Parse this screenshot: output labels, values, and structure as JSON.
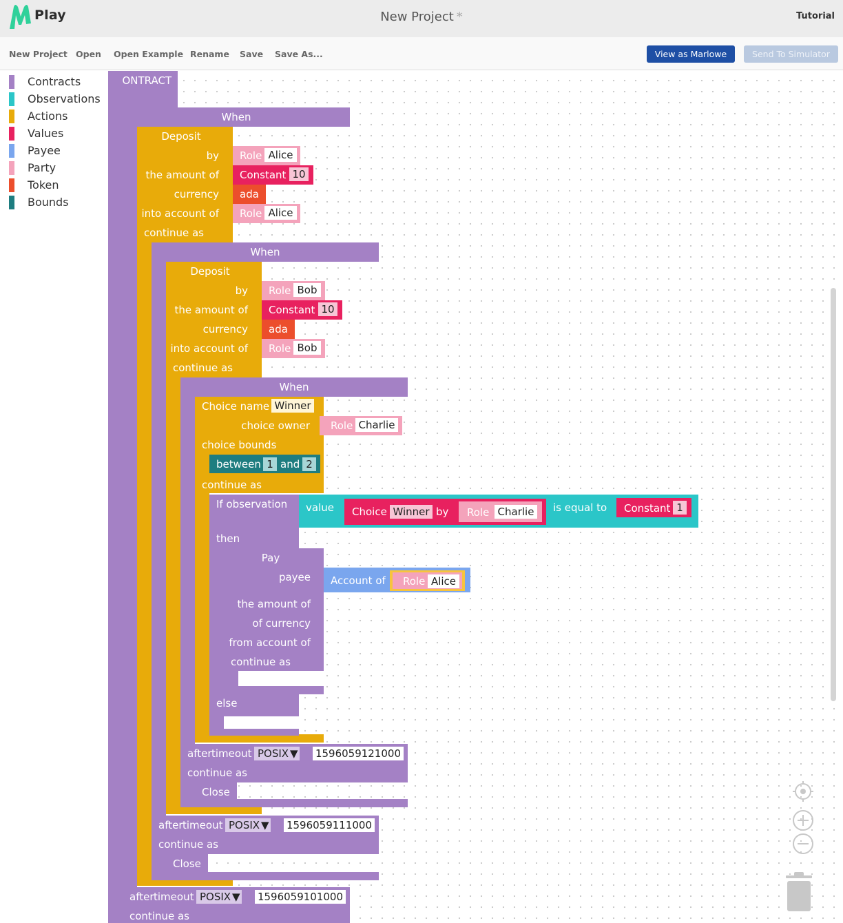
{
  "app": {
    "logo_text": "Play",
    "project_title": "New Project",
    "unsaved_mark": "*",
    "tutorial_label": "Tutorial"
  },
  "menu": {
    "new_project": "New Project",
    "open": "Open",
    "open_example": "Open Example",
    "rename": "Rename",
    "save": "Save",
    "save_as": "Save As...",
    "view_as_marlowe": "View as Marlowe",
    "send_to_simulator": "Send To Simulator"
  },
  "toolbox": [
    {
      "label": "Contracts",
      "color": "#a481c5"
    },
    {
      "label": "Observations",
      "color": "#2bc6c8"
    },
    {
      "label": "Actions",
      "color": "#e8ab0a"
    },
    {
      "label": "Values",
      "color": "#e8215f"
    },
    {
      "label": "Payee",
      "color": "#7aa6ee"
    },
    {
      "label": "Party",
      "color": "#f4a3bb"
    },
    {
      "label": "Token",
      "color": "#ec4e2c"
    },
    {
      "label": "Bounds",
      "color": "#1e7d80"
    }
  ],
  "blocks": {
    "contract": "CONTRACT",
    "when": "When",
    "deposit": "Deposit",
    "by": "by",
    "the_amount_of": "the amount of",
    "currency": "currency",
    "into_account_of": "into account of",
    "continue_as": "continue as",
    "role": "Role",
    "constant": "Constant",
    "ada": "ada",
    "alice": "Alice",
    "bob": "Bob",
    "charlie": "Charlie",
    "ten": "10",
    "choice_name": "Choice name",
    "winner": "Winner",
    "choice_owner": "choice owner",
    "choice_bounds": "choice bounds",
    "between": "between",
    "and": "and",
    "one": "1",
    "two": "2",
    "if_observation": "If observation",
    "value": "value",
    "choice": "Choice",
    "is_equal_to": "is equal to",
    "then": "then",
    "else": "else",
    "pay": "Pay",
    "payee": "payee",
    "account_of": "Account of",
    "of_currency": "of currency",
    "from_account_of": "from account of",
    "after": "after",
    "timeout": "timeout",
    "posix": "POSIX",
    "close": "Close",
    "timeout_1": "1596059121000",
    "timeout_2": "1596059111000",
    "timeout_3": "1596059101000"
  },
  "colors": {
    "contract": "#a481c5",
    "action": "#e8ab0a",
    "party": "#f4a3bb",
    "value": "#e8215f",
    "token": "#ec4e2c",
    "bound": "#1e7d80",
    "observation": "#2bc6c8",
    "payee": "#7aa6ee",
    "accent": "#1e4fa5"
  }
}
